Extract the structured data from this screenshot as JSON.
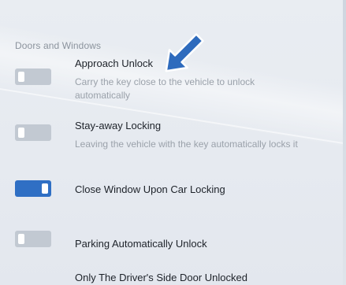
{
  "section": {
    "title": "Doors and Windows"
  },
  "settings": [
    {
      "title": "Approach Unlock",
      "description": "Carry the key close to the vehicle to unlock automatically",
      "enabled": false
    },
    {
      "title": "Stay-away Locking",
      "description": "Leaving the vehicle with the key automatically locks it",
      "enabled": false
    },
    {
      "title": "Close Window Upon Car Locking",
      "enabled": true
    },
    {
      "title": "Parking Automatically Unlock",
      "enabled": false
    },
    {
      "title": "Only The Driver's Side Door Unlocked"
    }
  ],
  "annotation": {
    "icon": "pointer-arrow-icon",
    "color": "#2e6bbd"
  },
  "colors": {
    "toggle_on": "#2f6fc4",
    "toggle_off": "#c2c9d2"
  }
}
